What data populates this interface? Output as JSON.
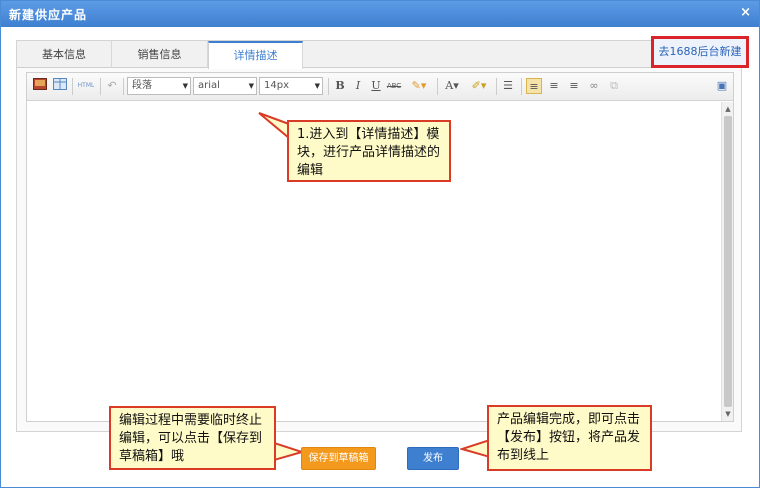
{
  "dialog": {
    "title": "新建供应产品",
    "close_label": "×"
  },
  "tabs": [
    {
      "label": "基本信息",
      "active": false
    },
    {
      "label": "销售信息",
      "active": false
    },
    {
      "label": "详情描述",
      "active": true
    }
  ],
  "link_1688": {
    "label": "去1688后台新建"
  },
  "toolbar": {
    "paragraph_select": "段落",
    "font_select": "arial",
    "size_select": "14px",
    "html_label": "HTML",
    "bold": "B",
    "italic": "I",
    "underline": "U",
    "strike": "ABC",
    "font_color": "A"
  },
  "callouts": {
    "step1": "1.进入到【详情描述】模块，进行产品详情描述的编辑",
    "draft_tip": "编辑过程中需要临时终止编辑，可以点击【保存到草稿箱】哦",
    "publish_tip": "产品编辑完成，即可点击【发布】按钮，将产品发布到线上"
  },
  "buttons": {
    "save_draft": "保存到草稿箱",
    "publish": "发布"
  },
  "colors": {
    "accent": "#3f7fd0",
    "callout_border": "#d93b26",
    "callout_fill": "#fffbc8",
    "draft_button": "#f39a1e",
    "highlight_border": "#d9252a"
  }
}
